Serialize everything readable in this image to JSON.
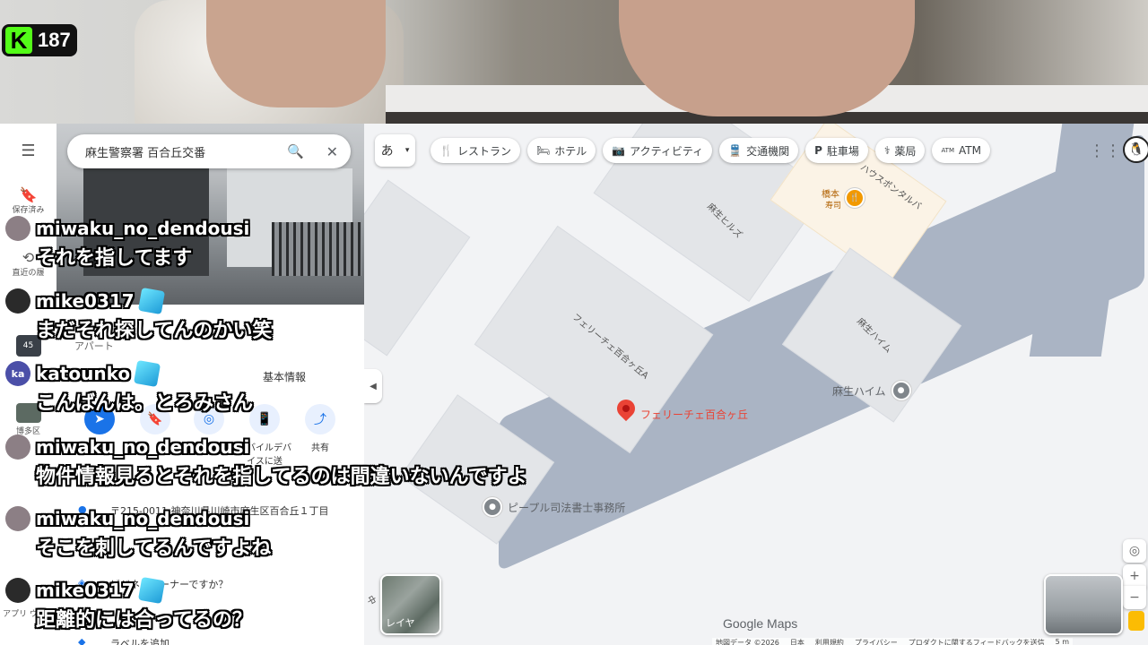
{
  "viewer_count": "187",
  "search": {
    "value": "麻生警察署 百合丘交番"
  },
  "rail": {
    "saved": "保存済み",
    "recent": "直近の履",
    "hakata": "博多区",
    "apps": "アプリ ウンロ",
    "badge45": "45"
  },
  "panel": {
    "apart": "アパート",
    "basic_info": "基本情報",
    "actions": {
      "mobile": "モバイルデバイスに送",
      "share": "共有"
    },
    "address": "〒215-0011 神奈川県川崎市麻生区百合丘１丁目",
    "owner": "ビジネスオーナーですか？",
    "add_label": "ラベルを追加"
  },
  "map": {
    "lang_button": "あ",
    "chips": [
      {
        "icon": "fork-knife-icon",
        "label": "レストラン"
      },
      {
        "icon": "bed-icon",
        "label": "ホテル"
      },
      {
        "icon": "camera-icon",
        "label": "アクティビティ"
      },
      {
        "icon": "train-icon",
        "label": "交通機関"
      },
      {
        "icon": "parking-icon",
        "label": "駐車場"
      },
      {
        "icon": "pharmacy-icon",
        "label": "薬局"
      },
      {
        "icon": "atm-icon",
        "label": "ATM"
      }
    ],
    "labels": {
      "asao_hills": "麻生ヒルズ",
      "house_pontarba": "ハウスポンタルバ",
      "hashimoto": "橋本",
      "sushi": "寿司",
      "felice_a": "フェリーチェ百合ヶ丘A",
      "asao_haim_bldg": "麻生ハイム",
      "asao_haim_poi": "麻生ハイム",
      "pin_label": "フェリーチェ百合ヶ丘",
      "people_office": "ピープル司法書士事務所",
      "naka": "中"
    },
    "layers_label": "レイヤ",
    "google_maps": "Google Maps",
    "footer": [
      "地図データ ©2026",
      "日本",
      "利用規約",
      "プライバシー",
      "プロダクトに関するフィードバックを送信",
      "5 m"
    ]
  },
  "chat": [
    {
      "user": "miwaku_no_dendousi",
      "text": "それを指してます",
      "avatar_color": "#8c7f85",
      "badge": false
    },
    {
      "user": "mike0317",
      "text": "まだそれ探してんのかい笑",
      "avatar_color": "#2a2a2a",
      "badge": true
    },
    {
      "user": "katounko",
      "text": "こんばんは。とろみさん",
      "avatar_color": "#4b4fa8",
      "badge": true,
      "avatar_text": "ka"
    },
    {
      "user": "miwaku_no_dendousi",
      "text": "物件情報見るとそれを指してるのは間違いないんですよ",
      "avatar_color": "#8c7f85",
      "badge": false
    },
    {
      "user": "miwaku_no_dendousi",
      "text": "そこを刺してるんですよね",
      "avatar_color": "#8c7f85",
      "badge": false
    },
    {
      "user": "mike0317",
      "text": "距離的には合ってるの？",
      "avatar_color": "#2a2a2a",
      "badge": true
    }
  ],
  "colors": {
    "kick_green": "#53fc18",
    "river": "#aab4c4",
    "pin_red": "#ea4335",
    "accent": "#1a73e8"
  }
}
